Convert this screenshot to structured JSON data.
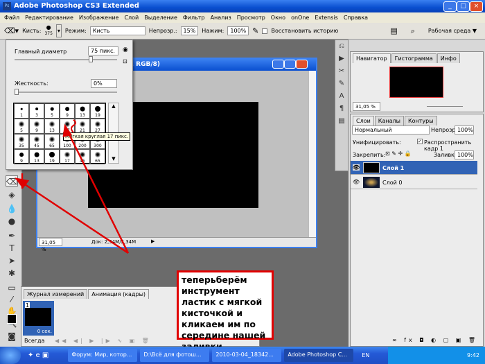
{
  "window": {
    "title": "Adobe Photoshop CS3 Extended",
    "app_icon": "Ps"
  },
  "menu": [
    "Файл",
    "Редактирование",
    "Изображение",
    "Слой",
    "Выделение",
    "Фильтр",
    "Анализ",
    "Просмотр",
    "Окно",
    "onOne",
    "Extensis",
    "Справка"
  ],
  "options": {
    "brush_label": "Кисть:",
    "brush_size": "375",
    "mode_label": "Режим:",
    "mode_value": "Кисть",
    "opacity_label": "Непрозр.:",
    "opacity_value": "15%",
    "flow_label": "Нажим:",
    "flow_value": "100%",
    "history_label": "Восстановить историю",
    "workspace_label": "Рабочая среда ▼"
  },
  "brush_popup": {
    "diameter_label": "Главный диаметр",
    "diameter_value": "75 пикс.",
    "diameter_level": 0.75,
    "hardness_label": "Жесткость:",
    "hardness_value": "0%",
    "hardness_level": 0,
    "presets": [
      {
        "size": "1",
        "hard": true
      },
      {
        "size": "3",
        "hard": true
      },
      {
        "size": "5",
        "hard": true
      },
      {
        "size": "9",
        "hard": true
      },
      {
        "size": "13",
        "hard": true
      },
      {
        "size": "19",
        "hard": true
      },
      {
        "size": "5",
        "hard": false
      },
      {
        "size": "9",
        "hard": false
      },
      {
        "size": "13",
        "hard": false
      },
      {
        "size": "17",
        "hard": false
      },
      {
        "size": "21",
        "hard": false
      },
      {
        "size": "27",
        "hard": false
      },
      {
        "size": "35",
        "hard": false
      },
      {
        "size": "45",
        "hard": false
      },
      {
        "size": "65",
        "hard": false
      },
      {
        "size": "100",
        "hard": false
      },
      {
        "size": "200",
        "hard": false
      },
      {
        "size": "300",
        "hard": false
      },
      {
        "size": "9",
        "hard": true
      },
      {
        "size": "13",
        "hard": true
      },
      {
        "size": "19",
        "hard": true
      },
      {
        "size": "17",
        "hard": false
      },
      {
        "size": "45",
        "hard": false
      },
      {
        "size": "65",
        "hard": false
      }
    ],
    "tooltip": "Мягкая круглая 17 пикс."
  },
  "document": {
    "title": "лой 1 , RGB/8)",
    "zoom": "31,05 %",
    "doc_info": "Док: 2,34M/2,34M"
  },
  "navigator": {
    "tabs": [
      "Навигатор",
      "Гистограмма",
      "Инфо"
    ],
    "zoom": "31,05 %"
  },
  "layers": {
    "tabs": [
      "Слои",
      "Каналы",
      "Контуры"
    ],
    "blend_mode": "Нормальный",
    "opacity_label": "Непрозр.:",
    "opacity_value": "100%",
    "unify_label": "Унифицировать:",
    "propagate_label": "Распространить кадр 1",
    "lock_label": "Закрепить:",
    "fill_label": "Заливка:",
    "fill_value": "100%",
    "items": [
      {
        "name": "Слой 1",
        "selected": true
      },
      {
        "name": "Слой 0",
        "selected": false
      }
    ]
  },
  "animation": {
    "tabs": [
      "Журнал измерений",
      "Анимация (кадры)"
    ],
    "frame_number": "1",
    "frame_delay": "0 сек.",
    "loop": "Всегда"
  },
  "callout": "теперьберём инструмент ластик с мягкой кисточкой и кликаем им по середине нашей заливки",
  "taskbar": {
    "items": [
      "Форум: Мир, котор...",
      "D:\\Всё для фотош...",
      "2010-03-04_18342...",
      "Adobe Photoshop C..."
    ],
    "lang": "EN",
    "clock": "9:42"
  },
  "colors": {
    "accent": "#3163b5",
    "annotation": "#e00000"
  }
}
